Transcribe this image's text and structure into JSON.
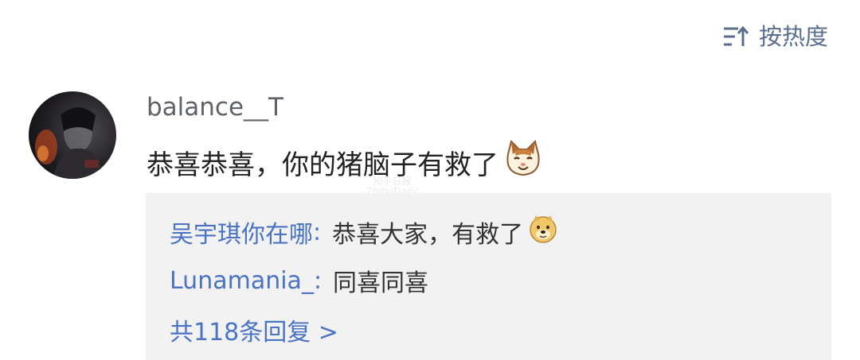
{
  "sort": {
    "label": "按热度",
    "icon": "sort-lines-icon"
  },
  "comment": {
    "avatar": "avatar",
    "username": "balance__T",
    "text": "恭喜恭喜，你的猪脑子有救了",
    "emoji": "cat-emoji"
  },
  "watermark": {
    "line1": "知乎日报",
    "line2": "ZhihuDaily"
  },
  "replies": [
    {
      "name": "吴宇琪你在哪",
      "separator": ":",
      "text": "恭喜大家，有救了",
      "emoji": "doge-emoji"
    },
    {
      "name": "Lunamania_",
      "separator": ":",
      "text": "同喜同喜"
    }
  ],
  "more": {
    "label": "共118条回复 >"
  }
}
